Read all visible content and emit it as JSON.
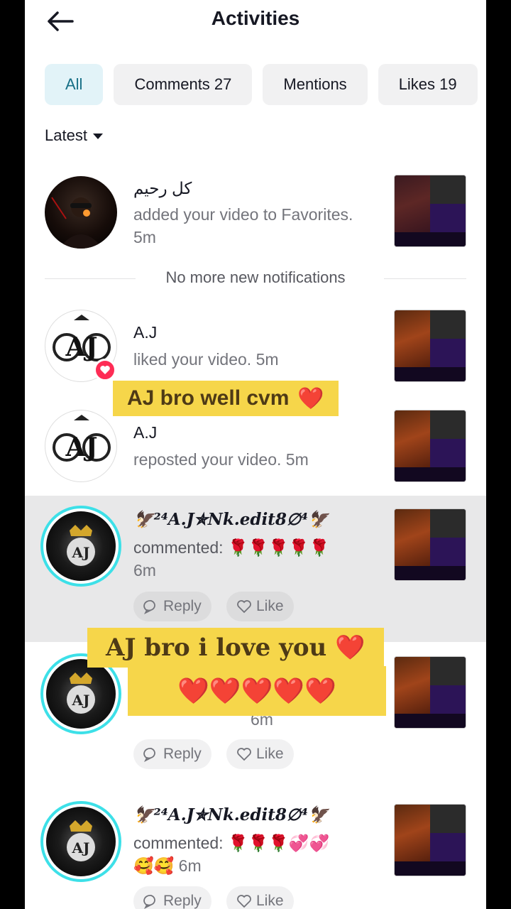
{
  "header": {
    "title": "Activities"
  },
  "tabs": [
    {
      "label": "All"
    },
    {
      "label": "Comments 27"
    },
    {
      "label": "Mentions"
    },
    {
      "label": "Likes 19"
    }
  ],
  "sort": {
    "label": "Latest"
  },
  "notifications": [
    {
      "user": "کل رحیم",
      "text": "added your video to Favorites. 5m"
    },
    {
      "user": "A.J",
      "text": "liked your video. 5m"
    },
    {
      "user": "A.J",
      "text": "reposted your video. 5m"
    },
    {
      "user": "🦅²⁴𝑨.𝑱✯𝑵𝒌.𝒆𝒅𝒊𝒕8∅⁴🦅",
      "text": "commented: 🌹🌹🌹🌹🌹",
      "time": "6m"
    },
    {
      "time": "6m"
    },
    {
      "user": "🦅²⁴𝑨.𝑱✯𝑵𝒌.𝒆𝒅𝒊𝒕8∅⁴🦅",
      "text": "commented: 🌹🌹🌹💞💞",
      "time": "🥰🥰 6m"
    }
  ],
  "separator": {
    "text": "No more new notifications"
  },
  "actions": {
    "reply": "Reply",
    "like": "Like"
  },
  "stickers": {
    "first": "AJ bro well cvm",
    "second_line1": "AJ bro i love you",
    "second_line2": "❤️❤️❤️❤️❤️",
    "heart": "❤️"
  },
  "colors": {
    "tab_active_bg": "#e2f3f8",
    "tab_active_text": "#166f86",
    "sticker_bg": "#f6d64a",
    "like_badge": "#fe2c55",
    "avatar_ring": "#3de0e8"
  },
  "icons": [
    "back-arrow-icon",
    "dropdown-triangle-icon",
    "heart-badge-icon",
    "comment-bubble-icon",
    "heart-outline-icon"
  ]
}
